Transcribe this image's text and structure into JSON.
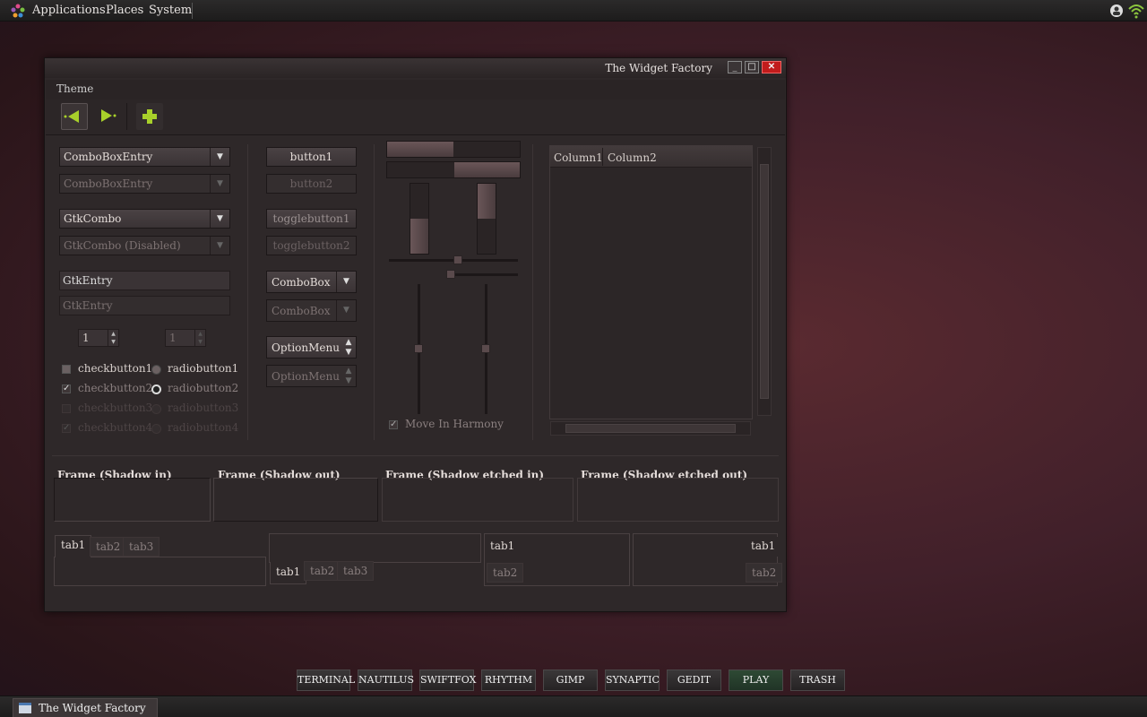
{
  "top_panel": {
    "menus": [
      "Applications",
      "Places",
      "System"
    ]
  },
  "window": {
    "title": "The Widget Factory",
    "controls": {
      "minimize": "_",
      "maximize": "□",
      "close": "✕"
    },
    "menu": {
      "theme": "Theme"
    },
    "col1": {
      "combo_entry": "ComboBoxEntry",
      "combo_entry_dis": "ComboBoxEntry",
      "gtk_combo": "GtkCombo",
      "gtk_combo_dis": "GtkCombo (Disabled)",
      "entry": "GtkEntry",
      "entry_dis": "GtkEntry",
      "spin1": "1",
      "spin2": "1",
      "check1": "checkbutton1",
      "check2": "checkbutton2",
      "check3": "checkbutton3",
      "check4": "checkbutton4",
      "radio1": "radiobutton1",
      "radio2": "radiobutton2",
      "radio3": "radiobutton3",
      "radio4": "radiobutton4"
    },
    "col2": {
      "button1": "button1",
      "button2": "button2",
      "toggle1": "togglebutton1",
      "toggle2": "togglebutton2",
      "combobox": "ComboBox",
      "combobox_dis": "ComboBox",
      "optionmenu": "OptionMenu",
      "optionmenu_dis": "OptionMenu"
    },
    "col3": {
      "harmony": "Move In Harmony"
    },
    "tree": {
      "columns": [
        "Column1",
        "Column2"
      ]
    },
    "frames": [
      "Frame (Shadow in)",
      "Frame (Shadow out)",
      "Frame (Shadow etched in)",
      "Frame (Shadow etched out)"
    ],
    "notebooks": {
      "tabs": [
        "tab1",
        "tab2",
        "tab3"
      ]
    }
  },
  "launchers": [
    "TERMINAL",
    "NAUTILUS",
    "SWIFTFOX",
    "RHYTHM",
    "GIMP",
    "SYNAPTIC",
    "GEDIT",
    "PLAY",
    "TRASH"
  ],
  "taskbar": {
    "task": "The Widget Factory"
  },
  "colors": {
    "accent": "#a8d02a",
    "close": "#c21c1c"
  }
}
